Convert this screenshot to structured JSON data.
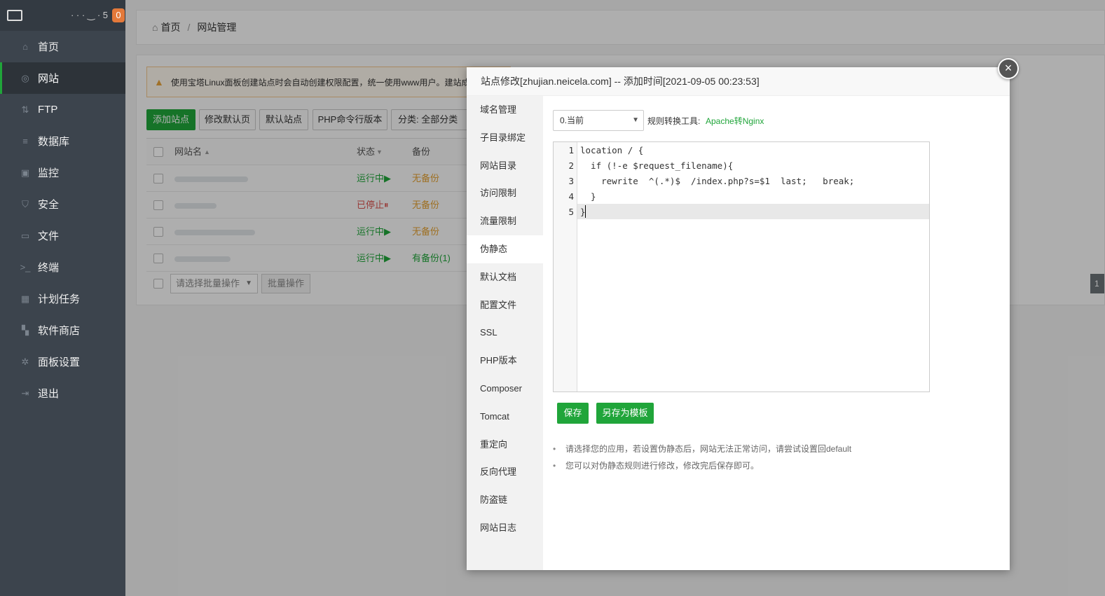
{
  "sidebar": {
    "host": "·  ·  ·  ‿  ·  5",
    "badge": "0",
    "items": [
      {
        "label": "首页",
        "icon": "home-icon",
        "glyph": "⌂"
      },
      {
        "label": "网站",
        "icon": "globe-icon",
        "glyph": "◎"
      },
      {
        "label": "FTP",
        "icon": "ftp-icon",
        "glyph": "⇅"
      },
      {
        "label": "数据库",
        "icon": "database-icon",
        "glyph": "≡"
      },
      {
        "label": "监控",
        "icon": "monitor-icon",
        "glyph": "▣"
      },
      {
        "label": "安全",
        "icon": "shield-icon",
        "glyph": "⛉"
      },
      {
        "label": "文件",
        "icon": "folder-icon",
        "glyph": "▭"
      },
      {
        "label": "终端",
        "icon": "terminal-icon",
        "glyph": ">_"
      },
      {
        "label": "计划任务",
        "icon": "calendar-icon",
        "glyph": "▦"
      },
      {
        "label": "软件商店",
        "icon": "grid-icon",
        "glyph": "▚"
      },
      {
        "label": "面板设置",
        "icon": "gear-icon",
        "glyph": "✲"
      },
      {
        "label": "退出",
        "icon": "logout-icon",
        "glyph": "⇥"
      }
    ]
  },
  "breadcrumb": {
    "home": "首页",
    "sep": "/",
    "current": "网站管理"
  },
  "notice": "使用宝塔Linux面板创建站点时会自动创建权限配置，统一使用www用户。建站成",
  "toolbar": {
    "add_site": "添加站点",
    "default_page": "修改默认页",
    "default_site": "默认站点",
    "php_cli": "PHP命令行版本",
    "category": "分类: 全部分类"
  },
  "table": {
    "headers": {
      "name": "网站名",
      "status": "状态",
      "backup": "备份"
    },
    "rows": [
      {
        "status": "运行中▶",
        "backup": "无备份"
      },
      {
        "status": "已停止⏸",
        "backup": "无备份"
      },
      {
        "status": "运行中▶",
        "backup": "无备份"
      },
      {
        "status": "运行中▶",
        "backup": "有备份(1)"
      }
    ]
  },
  "bulk": {
    "placeholder": "请选择批量操作",
    "button": "批量操作"
  },
  "pager": "1",
  "modal": {
    "title": "站点修改[zhujian.neicela.com] -- 添加时间[2021-09-05 00:23:53]",
    "close": "×",
    "tabs": [
      "域名管理",
      "子目录绑定",
      "网站目录",
      "访问限制",
      "流量限制",
      "伪静态",
      "默认文档",
      "配置文件",
      "SSL",
      "PHP版本",
      "Composer",
      "Tomcat",
      "重定向",
      "反向代理",
      "防盗链",
      "网站日志"
    ],
    "active_tab": "伪静态",
    "select_value": "0.当前",
    "rule_label": "规则转换工具:",
    "rule_link": "Apache转Nginx",
    "code_lines": [
      {
        "n": "1",
        "text": "location / {"
      },
      {
        "n": "2",
        "text": "  if (!-e $request_filename){"
      },
      {
        "n": "3",
        "text": "    rewrite  ^(.*)$  /index.php?s=$1  last;   break;"
      },
      {
        "n": "4",
        "text": "  }"
      },
      {
        "n": "5",
        "text": "}"
      }
    ],
    "save": "保存",
    "save_template": "另存为模板",
    "tips": [
      "请选择您的应用，若设置伪静态后，网站无法正常访问，请尝试设置回default",
      "您可以对伪静态规则进行修改，修改完后保存即可。"
    ]
  }
}
